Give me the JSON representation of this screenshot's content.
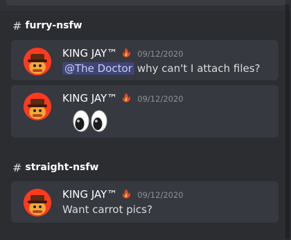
{
  "colors": {
    "background": "#2b2d31",
    "card": "#36393f",
    "username": "#ffffff",
    "timestamp": "#8e9297",
    "mention_bg": "#5865f2",
    "avatar_bg": "#ff3a1f"
  },
  "sections": [
    {
      "hash_symbol": "#",
      "channel_name": "furry-nsfw",
      "messages": [
        {
          "username": "KING JAY™",
          "badge_icon": "flame-icon",
          "timestamp": "09/12/2020",
          "mention": "@The Doctor",
          "text": "why can't I attach files?"
        },
        {
          "username": "KING JAY™",
          "badge_icon": "flame-icon",
          "timestamp": "09/12/2020",
          "emoji": "eyes-emoji"
        }
      ]
    },
    {
      "hash_symbol": "#",
      "channel_name": "straight-nsfw",
      "messages": [
        {
          "username": "KING JAY™",
          "badge_icon": "flame-icon",
          "timestamp": "09/12/2020",
          "text": "Want carrot pics?"
        }
      ]
    }
  ]
}
